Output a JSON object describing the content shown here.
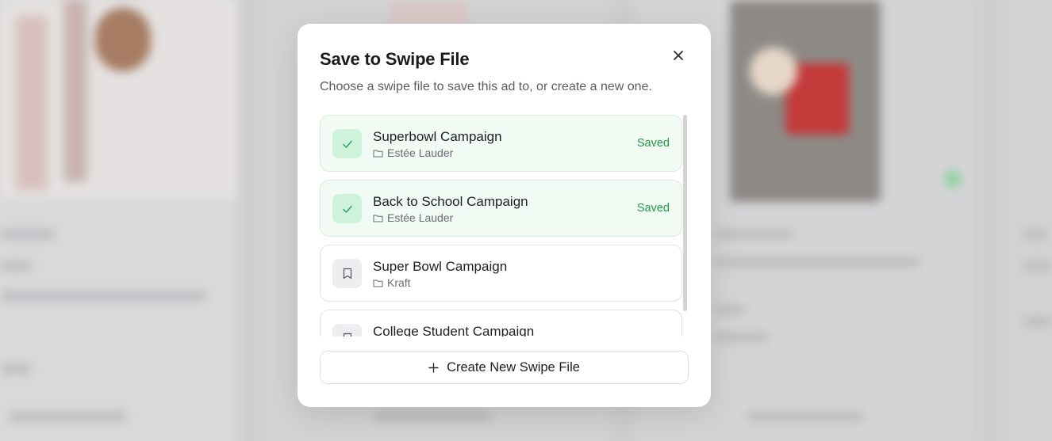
{
  "modal": {
    "title": "Save to Swipe File",
    "subtitle": "Choose a swipe file to save this ad to, or create a new one.",
    "close_icon": "close-icon",
    "items": [
      {
        "name": "Superbowl Campaign",
        "folder": "Estée Lauder",
        "status": "Saved",
        "saved": true,
        "icon": "check-icon"
      },
      {
        "name": "Back to School Campaign",
        "folder": "Estée Lauder",
        "status": "Saved",
        "saved": true,
        "icon": "check-icon"
      },
      {
        "name": "Super Bowl Campaign",
        "folder": "Kraft",
        "status": "",
        "saved": false,
        "icon": "bookmark-icon"
      },
      {
        "name": "College Student Campaign",
        "folder": "",
        "status": "",
        "saved": false,
        "icon": "bookmark-icon"
      }
    ],
    "create_button_label": "Create New Swipe File",
    "create_icon": "plus-icon"
  },
  "colors": {
    "saved_green": "#1e9a45",
    "saved_bg": "#f1fbf4",
    "check_bg": "#cdf3da"
  }
}
